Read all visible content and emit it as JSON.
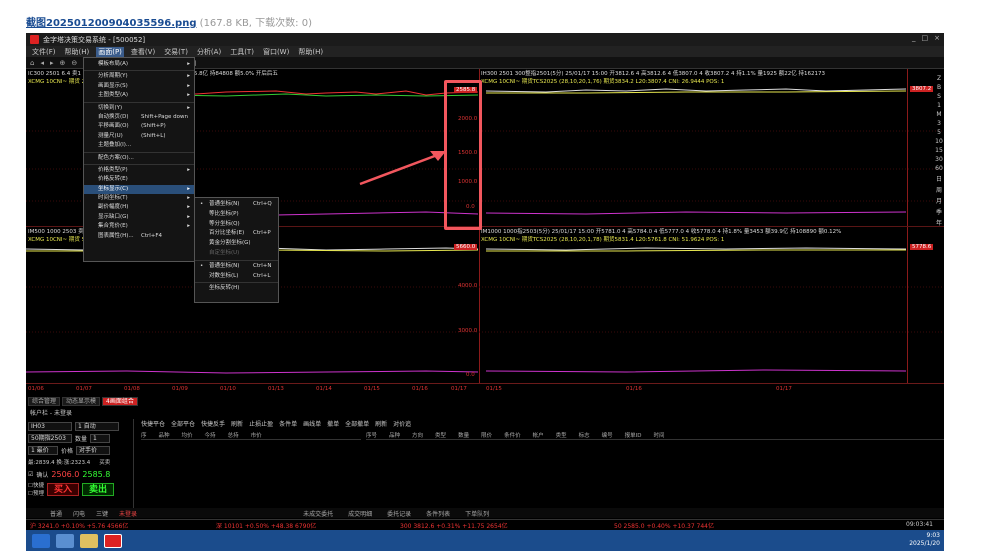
{
  "forum": {
    "filename": "截图20250120090403559​6.png",
    "meta": "(167.8 KB, 下载次数: 0)"
  },
  "app": {
    "title": "金字塔决策交易系统 - [500052]",
    "menu": [
      "文件(F)",
      "帮助(H)",
      "画面(P)",
      "查看(V)",
      "交易(T)",
      "分析(A)",
      "工具(T)",
      "窗口(W)",
      "帮助(H)"
    ],
    "active_menu_index": 2
  },
  "charts": {
    "top_left": {
      "info": "IC300 2501 6.4 卖1 2585.0 4 买1 2585.8 4 持1.18% 量748 额5.8亿 持84808 额5.0% 开后后五",
      "info2": "XCMG 10CNI~ 期货 2585.3 2584.8 CNI: 16.9054 POS: 0"
    },
    "top_right": {
      "info": "IH300 2501 300整指2501(5分) 25/01/17 15:00 开3812.6 4 高3812.6 4 低3807.0 4 收3807.2 4 持1.1% 量1925 额22亿 持162173",
      "info2": "XCMG 10CNI~ 期货TCS2025 (28,10,20,1,76) 期货3834.2 L20:3807.4 CNI: 26.9444 POS: 1"
    },
    "bottom_left": {
      "info": "IM500 1000 2503 卖1 买1.19% 量1298 额15.5亿 持121660 额0.12% 收后五",
      "info2": "XCMG 10CNI~ 期货 S034.6 CNI: POS:"
    },
    "bottom_right": {
      "info": "IM1000 1000指2503(5分) 25/01/17 15:00 开5781.0 4 高5784.0 4 低5777.0 4 收5778.0 4 持1.8% 量3453 额39.9亿 持108890 额0.12%",
      "info2": "XCMG 10CNI~ 期货TCS2025 (28,10,20,1,78) 期货5831.4 L20:5761.8 CNI: 51.9624 POS: 1"
    },
    "yaxis_top": [
      "2585.8",
      "2000.0",
      "1500.0",
      "1000.0",
      "0.0"
    ],
    "yaxis_bottom": [
      "5660.0",
      "4000.0",
      "3000.0",
      "0.0"
    ],
    "yaxis_right_top": "3807.2",
    "yaxis_right_bottom": "5778.6",
    "time_labels": [
      "01/06",
      "01/07",
      "01/08",
      "01/09",
      "01/10",
      "01/13",
      "01/14",
      "01/15",
      "01/16",
      "01/17",
      "01/15",
      "01/16",
      "01/17"
    ]
  },
  "menu1": {
    "items": [
      {
        "label": "模板布局(A)",
        "sc": "",
        "ar": "▸"
      },
      {
        "sep": true
      },
      {
        "label": "分析周期(Y)",
        "sc": "",
        "ar": "▸"
      },
      {
        "label": "画面显示(S)",
        "sc": "",
        "ar": "▸"
      },
      {
        "label": "主图类型(A)",
        "sc": "",
        "ar": "▸"
      },
      {
        "sep": true
      },
      {
        "label": "切换到(Y)",
        "sc": "",
        "ar": "▸"
      },
      {
        "label": "自动换页(D)",
        "sc": "Shift+Page down",
        "ar": ""
      },
      {
        "label": "平移画面(O)",
        "sc": "(Shift+P)",
        "ar": ""
      },
      {
        "label": "测量尺(U)",
        "sc": "(Shift+L)",
        "ar": ""
      },
      {
        "label": "主题叠加(I)...",
        "sc": "",
        "ar": ""
      },
      {
        "sep": true
      },
      {
        "label": "配色方案(O)...",
        "sc": "",
        "ar": ""
      },
      {
        "sep": true
      },
      {
        "label": "价格类型(P)",
        "sc": "",
        "ar": "▸"
      },
      {
        "label": "价格反转(E)",
        "sc": "",
        "ar": ""
      },
      {
        "label": "坐标显示(C)",
        "sc": "",
        "ar": "▸",
        "hl": true
      },
      {
        "label": "时间坐标(T)",
        "sc": "",
        "ar": "▸"
      },
      {
        "label": "副价幅度(H)",
        "sc": "",
        "ar": "▸"
      },
      {
        "label": "显示缺口(G)",
        "sc": "",
        "ar": "▸"
      },
      {
        "label": "集合竞价(E)",
        "sc": "",
        "ar": "▸"
      },
      {
        "label": "图表属性(H)...",
        "sc": "Ctrl+F4",
        "ar": ""
      }
    ]
  },
  "menu2": {
    "items": [
      {
        "label": "普通坐标(N)",
        "sc": "Ctrl+Q",
        "chk": "•"
      },
      {
        "label": "等比坐标(P)",
        "sc": "",
        "chk": ""
      },
      {
        "label": "等分坐标(Q)",
        "sc": "",
        "chk": ""
      },
      {
        "label": "百分比坐标(E)",
        "sc": "Ctrl+P",
        "chk": ""
      },
      {
        "label": "黄金分割坐标(G)",
        "sc": "",
        "chk": ""
      },
      {
        "label": "自定坐标(U)",
        "sc": "",
        "chk": "",
        "dim": true
      },
      {
        "sep": true
      },
      {
        "label": "普通坐标(N)",
        "sc": "Ctrl+N",
        "chk": "•"
      },
      {
        "label": "对数坐标(L)",
        "sc": "Ctrl+L",
        "chk": ""
      },
      {
        "sep": true
      },
      {
        "label": "坐标反转(H)",
        "sc": "",
        "chk": ""
      }
    ]
  },
  "tabs": [
    "综合管理",
    "动态显示模",
    "4画面组合"
  ],
  "active_tab_index": 2,
  "trade": {
    "account": "帐户栏 - 未登录",
    "buttons": [
      "快捷平仓",
      "全部平仓",
      "快捷反手",
      "刷新",
      "止损止盈",
      "条件单",
      "画线单",
      "撤单",
      "全部撤单",
      "刷新",
      "对价追"
    ],
    "code": "IH03",
    "auto": "1 自动",
    "name": "50期指2503",
    "qty_label": "数量",
    "qty": "1",
    "price_type_label": "1 最价",
    "price_label": "价格",
    "price_value": "对手价",
    "hint": "最:2839.4 换:涨:2323.4",
    "hint2": "买卖",
    "chk1": "确认",
    "chk2": "快捷",
    "chk3": "预埋",
    "buy_price": "2506.0",
    "sell_price": "2585.8",
    "buy_label": "买入",
    "sell_label": "卖出",
    "pos_headers": [
      "序",
      "品种",
      "均价",
      "今持",
      "总持",
      "市价"
    ],
    "order_headers": [
      "序号",
      "品种",
      "方向",
      "类型",
      "数量",
      "限价",
      "条件价",
      "帐户",
      "类型",
      "标志",
      "编号",
      "报单ID",
      "时间"
    ]
  },
  "bottom_tabs": [
    "普通",
    "闪电",
    "三键",
    "未登录"
  ],
  "bottom_tabs2": [
    "未成交委托",
    "成交明细",
    "委托记录",
    "条件列表",
    "下单队列"
  ],
  "status": [
    {
      "txt": "沪 3241.0 +0.10% +5.76 4566亿",
      "color": "#e33"
    },
    {
      "txt": "深 10101 +0.50% +48.38 6790亿",
      "color": "#e33"
    },
    {
      "txt": "300 3812.6 +0.31% +11.75 2654亿",
      "color": "#e33"
    },
    {
      "txt": "50 2585.0 +0.40% +10.37 744亿",
      "color": "#e33"
    }
  ],
  "clock": {
    "time": "9:03",
    "date": "2025/1/20"
  },
  "clock_status": "09:03:41"
}
